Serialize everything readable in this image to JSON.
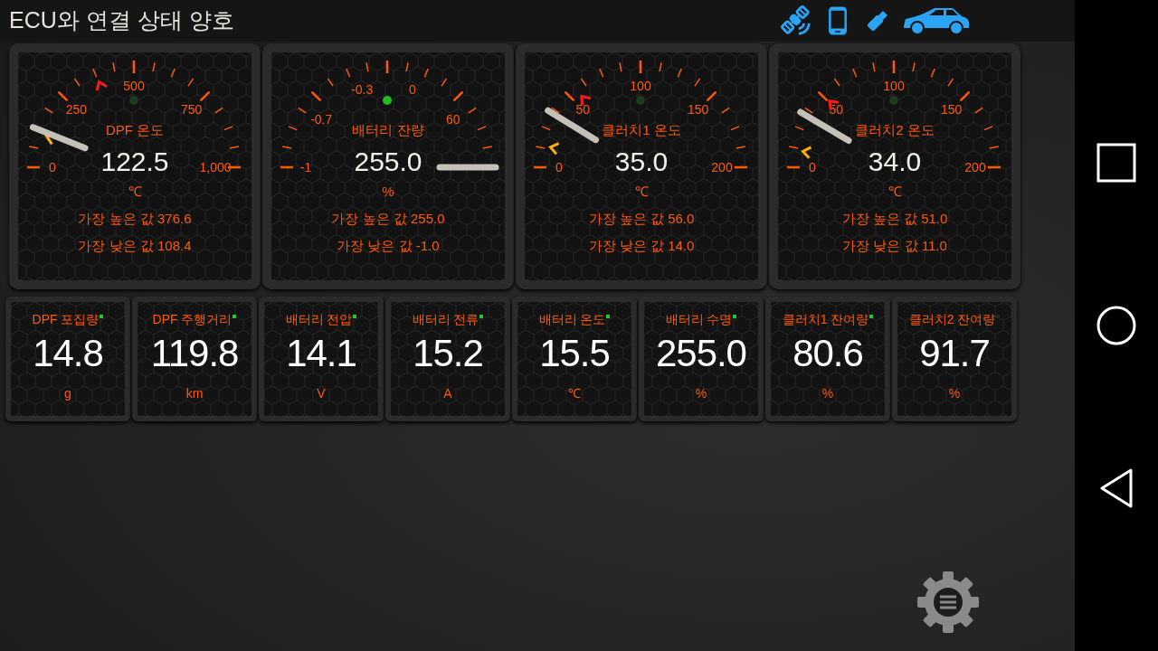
{
  "status_bar": {
    "title": "ECU와 연결 상태 양호"
  },
  "gauges": [
    {
      "title": "DPF 온도",
      "value": "122.5",
      "unit": "℃",
      "high": "가장 높은 값 376.6",
      "low": "가장 낮은 값 108.4",
      "scale": [
        "0",
        "250",
        "500",
        "750",
        "1,000"
      ],
      "indicator_on": false
    },
    {
      "title": "배터리 잔량",
      "value": "255.0",
      "unit": "%",
      "high": "가장 높은 값 255.0",
      "low": "가장 낮은 값 -1.0",
      "scale": [
        "-1",
        "-0.7",
        "-0.3",
        "0",
        "60"
      ],
      "indicator_on": true
    },
    {
      "title": "클러치1 온도",
      "value": "35.0",
      "unit": "℃",
      "high": "가장 높은 값 56.0",
      "low": "가장 낮은 값 14.0",
      "scale": [
        "0",
        "50",
        "100",
        "150",
        "200"
      ],
      "indicator_on": false
    },
    {
      "title": "클러치2 온도",
      "value": "34.0",
      "unit": "℃",
      "high": "가장 높은 값 51.0",
      "low": "가장 낮은 값 11.0",
      "scale": [
        "0",
        "50",
        "100",
        "150",
        "200"
      ],
      "indicator_on": false
    }
  ],
  "tiles": [
    {
      "title": "DPF 포집량",
      "value": "14.8",
      "unit": "g",
      "indicator_on": true
    },
    {
      "title": "DPF 주행거리",
      "value": "119.8",
      "unit": "km",
      "indicator_on": true
    },
    {
      "title": "배터리 전압",
      "value": "14.1",
      "unit": "V",
      "indicator_on": true
    },
    {
      "title": "배터리 전류",
      "value": "15.2",
      "unit": "A",
      "indicator_on": true
    },
    {
      "title": "배터리 온도",
      "value": "15.5",
      "unit": "℃",
      "indicator_on": true
    },
    {
      "title": "배터리 수명",
      "value": "255.0",
      "unit": "%",
      "indicator_on": true
    },
    {
      "title": "클러치1 잔여량",
      "value": "80.6",
      "unit": "%",
      "indicator_on": true
    },
    {
      "title": "클러치2 잔여량",
      "value": "91.7",
      "unit": "%",
      "indicator_on": false
    }
  ]
}
